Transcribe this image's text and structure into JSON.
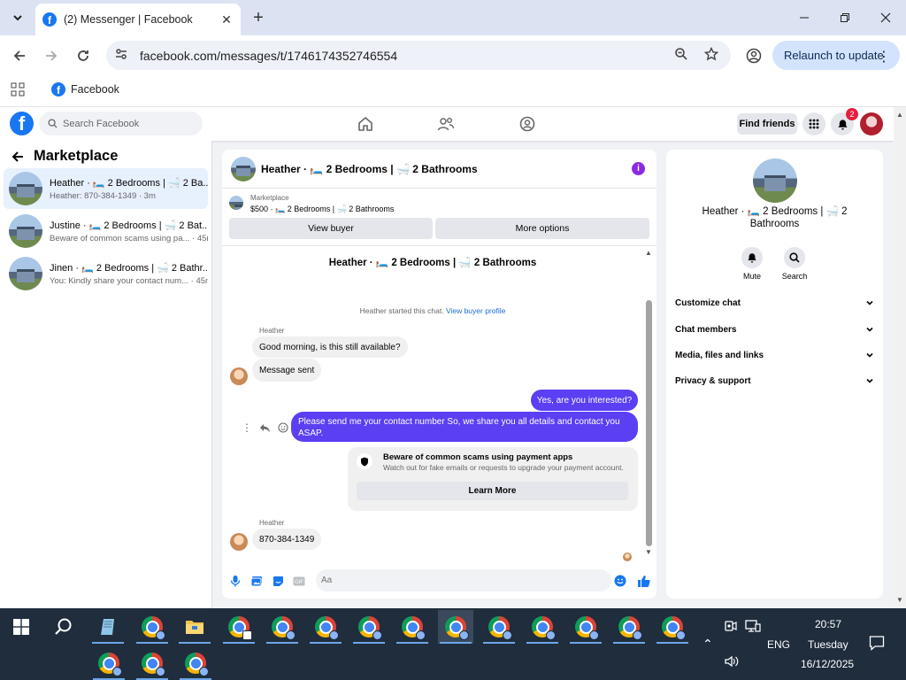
{
  "browser": {
    "tab_title": "(2) Messenger | Facebook",
    "url": "facebook.com/messages/t/1746174352746554",
    "relaunch_label": "Relaunch to update",
    "bookmark_facebook": "Facebook"
  },
  "fb": {
    "search_placeholder": "Search Facebook",
    "find_friends": "Find friends",
    "notification_count": "2"
  },
  "marketplace": {
    "title": "Marketplace",
    "conversations": [
      {
        "name": "Heather · 🛏️ 2 Bedrooms | 🛁 2 Ba...",
        "snippet": "Heather: 870-384-1349 · 3m",
        "active": true
      },
      {
        "name": "Justine · 🛏️ 2 Bedrooms | 🛁 2 Bat...",
        "snippet": "Beware of common scams using pa... · 45m",
        "active": false
      },
      {
        "name": "Jinen · 🛏️ 2 Bedrooms | 🛁 2 Bathr...",
        "snippet": "You: Kindly share your contact num... · 45m",
        "active": false
      }
    ]
  },
  "chat": {
    "header_title": "Heather · 🛏️ 2 Bedrooms | 🛁 2 Bathrooms",
    "listing_label": "Marketplace",
    "listing_price": "$500 · 🛏️ 2 Bedrooms | 🛁 2 Bathrooms",
    "view_buyer": "View buyer",
    "more_options": "More options",
    "thread_title": "Heather · 🛏️ 2 Bedrooms | 🛁 2 Bathrooms",
    "started_text": "Heather started this chat.",
    "view_profile": "View buyer profile",
    "sender_name": "Heather",
    "msg_in_1": "Good morning, is this still available?",
    "msg_in_2": "Message sent",
    "msg_out_1": "Yes, are you interested?",
    "msg_out_2": "Please send me your contact number So, we share you all details and contact you ASAP.",
    "scam_title": "Beware of common scams using payment apps",
    "scam_sub": "Watch out for fake emails or requests to upgrade your payment account.",
    "learn_more": "Learn More",
    "sender_name_2": "Heather",
    "msg_in_3": "870-384-1349",
    "composer_placeholder": "Aa"
  },
  "info": {
    "name": "Heather · 🛏️ 2 Bedrooms | 🛁 2 Bathrooms",
    "mute": "Mute",
    "search": "Search",
    "sections": [
      "Customize chat",
      "Chat members",
      "Media, files and links",
      "Privacy & support"
    ]
  },
  "taskbar": {
    "time": "20:57",
    "day": "Tuesday",
    "date": "16/12/2025",
    "lang": "ENG"
  },
  "colors": {
    "fb_blue": "#1877f2",
    "outgoing_bubble": "#5b3ff2",
    "active_conversation": "#e7f0fd"
  }
}
